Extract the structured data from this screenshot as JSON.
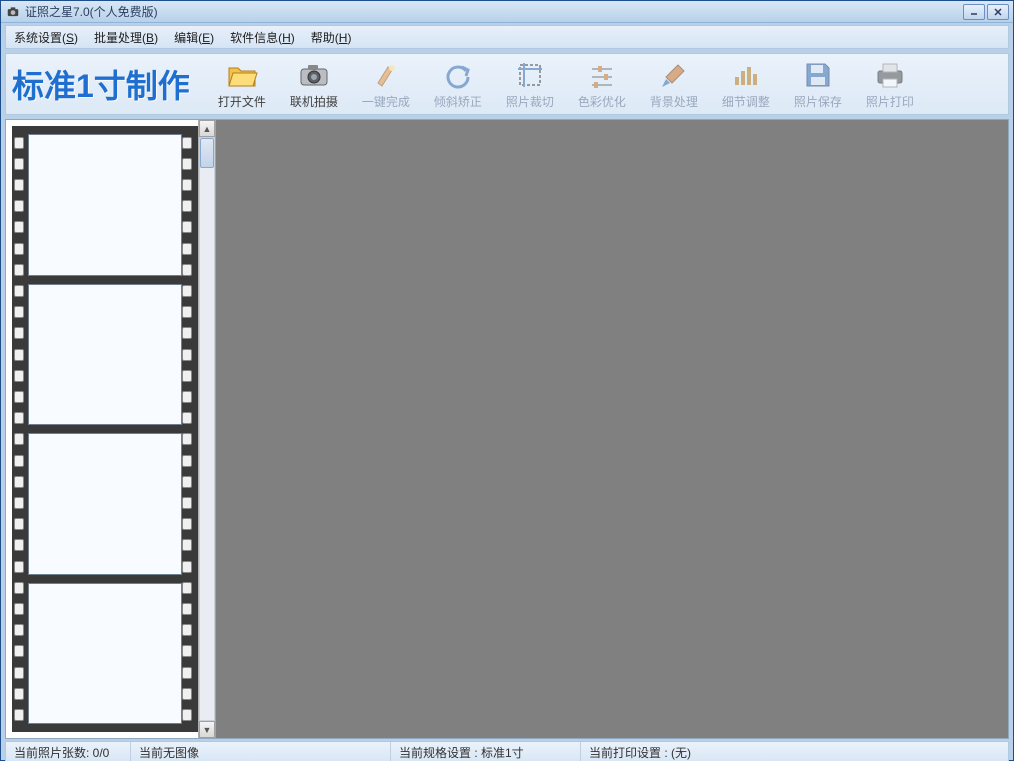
{
  "window": {
    "title": "证照之星7.0(个人免费版)"
  },
  "menu": {
    "items": [
      {
        "label": "系统设置",
        "accel": "S"
      },
      {
        "label": "批量处理",
        "accel": "B"
      },
      {
        "label": "编辑",
        "accel": "E"
      },
      {
        "label": "软件信息",
        "accel": "H"
      },
      {
        "label": "帮助",
        "accel": "H"
      }
    ]
  },
  "toolbar": {
    "title": "标准1寸制作",
    "buttons": [
      {
        "id": "open-file",
        "label": "打开文件",
        "icon": "folder-icon",
        "enabled": true
      },
      {
        "id": "camera-shoot",
        "label": "联机拍摄",
        "icon": "camera-icon",
        "enabled": true
      },
      {
        "id": "one-click",
        "label": "一键完成",
        "icon": "wand-icon",
        "enabled": false
      },
      {
        "id": "tilt-correct",
        "label": "倾斜矫正",
        "icon": "rotate-icon",
        "enabled": false
      },
      {
        "id": "crop",
        "label": "照片裁切",
        "icon": "crop-icon",
        "enabled": false
      },
      {
        "id": "color-opt",
        "label": "色彩优化",
        "icon": "sliders-icon",
        "enabled": false
      },
      {
        "id": "bg-process",
        "label": "背景处理",
        "icon": "brush-icon",
        "enabled": false
      },
      {
        "id": "detail-adj",
        "label": "细节调整",
        "icon": "levels-icon",
        "enabled": false
      },
      {
        "id": "save",
        "label": "照片保存",
        "icon": "floppy-icon",
        "enabled": false
      },
      {
        "id": "print",
        "label": "照片打印",
        "icon": "printer-icon",
        "enabled": false
      }
    ]
  },
  "status": {
    "photo_count": "当前照片张数: 0/0",
    "image_state": "当前无图像",
    "spec": "当前规格设置 : 标准1寸",
    "print": "当前打印设置 :  (无)"
  }
}
